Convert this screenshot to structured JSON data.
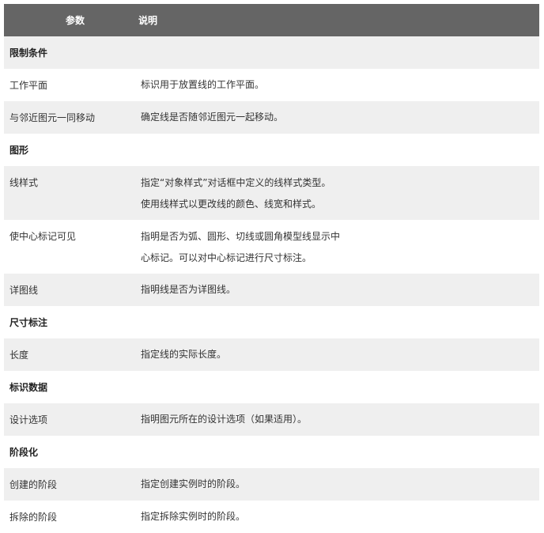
{
  "header": {
    "col_param": "参数",
    "col_desc": "说明"
  },
  "rows": [
    {
      "type": "section",
      "label": "限制条件"
    },
    {
      "type": "item",
      "param": "工作平面",
      "desc": [
        "标识用于放置线的工作平面。"
      ]
    },
    {
      "type": "item",
      "param": "与邻近图元一同移动",
      "desc": [
        "确定线是否随邻近图元一起移动。"
      ]
    },
    {
      "type": "section",
      "label": "图形"
    },
    {
      "type": "item",
      "param": "线样式",
      "desc": [
        "指定“对象样式”对话框中定义的线样式类型。",
        "使用线样式以更改线的颜色、线宽和样式。"
      ]
    },
    {
      "type": "item",
      "param": "使中心标记可见",
      "desc": [
        "指明是否为弧、圆形、切线或圆角模型线显示中",
        "心标记。可以对中心标记进行尺寸标注。"
      ]
    },
    {
      "type": "item",
      "param": "详图线",
      "desc": [
        "指明线是否为详图线。"
      ]
    },
    {
      "type": "section",
      "label": "尺寸标注"
    },
    {
      "type": "item",
      "param": "长度",
      "desc": [
        "指定线的实际长度。"
      ]
    },
    {
      "type": "section",
      "label": "标识数据"
    },
    {
      "type": "item",
      "param": "设计选项",
      "desc": [
        "指明图元所在的设计选项（如果适用）。"
      ]
    },
    {
      "type": "section",
      "label": "阶段化"
    },
    {
      "type": "item",
      "param": "创建的阶段",
      "desc": [
        "指定创建实例时的阶段。"
      ]
    },
    {
      "type": "item",
      "param": "拆除的阶段",
      "desc": [
        "指定拆除实例时的阶段。"
      ]
    }
  ]
}
